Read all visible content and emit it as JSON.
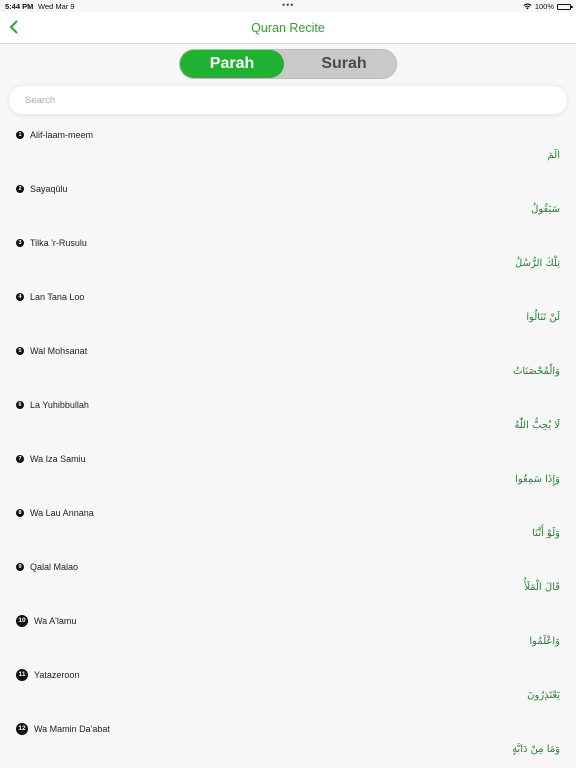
{
  "status_bar": {
    "time": "5:44 PM",
    "date": "Wed Mar 9",
    "battery": "100%"
  },
  "nav": {
    "title": "Quran Recite"
  },
  "segments": {
    "parah": "Parah",
    "surah": "Surah",
    "selected": "Parah"
  },
  "search": {
    "placeholder": "Search",
    "value": ""
  },
  "colors": {
    "accent": "#1fb12f",
    "title": "#2aa52e",
    "arabic": "#1b8a2c"
  },
  "parahs": [
    {
      "num": "1",
      "name": "Alif-laam-meem",
      "arabic": "الٓمٓ"
    },
    {
      "num": "2",
      "name": "Sayaqûlu",
      "arabic": "سَيَقُولُ"
    },
    {
      "num": "3",
      "name": "Tilka 'r-Rusulu",
      "arabic": "تِلْكَ الرُّسُلُ"
    },
    {
      "num": "4",
      "name": "Lan Tana Loo",
      "arabic": "لَنْ تَنَالُوا"
    },
    {
      "num": "5",
      "name": "Wal Mohsanat",
      "arabic": "وَالْمُحْصَنَاتُ"
    },
    {
      "num": "6",
      "name": "La Yuhibbullah",
      "arabic": "لَا يُحِبُّ اللّٰهُ"
    },
    {
      "num": "7",
      "name": "Wa Iza Samiu",
      "arabic": "وَإِذَا سَمِعُوا"
    },
    {
      "num": "8",
      "name": "Wa Lau Annana",
      "arabic": "وَلَوْ أَنَّنَا"
    },
    {
      "num": "9",
      "name": "Qalal Malao",
      "arabic": "قَالَ الْمَلَأُ"
    },
    {
      "num": "10",
      "name": "Wa A'lamu",
      "arabic": "وَاعْلَمُوا"
    },
    {
      "num": "11",
      "name": "Yatazeroon",
      "arabic": "يَعْتَذِرُونَ"
    },
    {
      "num": "12",
      "name": "Wa Mamin Da'abat",
      "arabic": "وَمَا مِنْ دَابَّةٍ"
    }
  ]
}
